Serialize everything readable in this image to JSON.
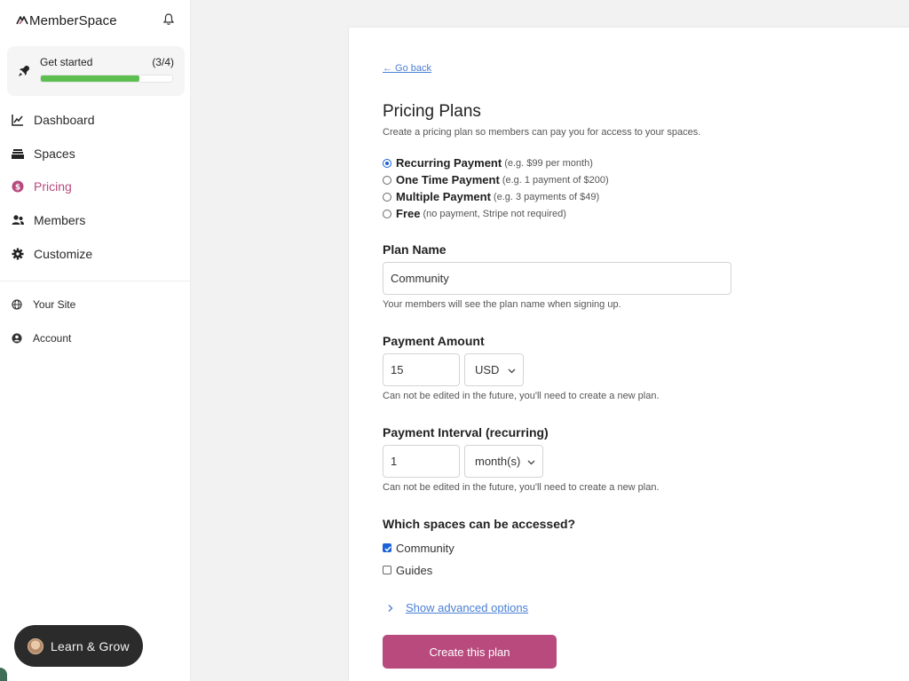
{
  "sidebar": {
    "brand": "MemberSpace",
    "get_started": {
      "title": "Get started",
      "count": "(3/4)",
      "progress": 0.75
    },
    "nav": [
      {
        "label": "Dashboard",
        "icon": "chart-icon"
      },
      {
        "label": "Spaces",
        "icon": "stack-icon"
      },
      {
        "label": "Pricing",
        "icon": "dollar-icon",
        "active": true
      },
      {
        "label": "Members",
        "icon": "people-icon"
      },
      {
        "label": "Customize",
        "icon": "gear-icon"
      }
    ],
    "secondary": [
      {
        "label": "Your Site",
        "icon": "globe-icon"
      },
      {
        "label": "Account",
        "icon": "user-circle-icon"
      }
    ],
    "learn_button": "Learn & Grow"
  },
  "main": {
    "back_link": "← Go back",
    "title": "Pricing Plans",
    "description": "Create a pricing plan so members can pay you for access to your spaces.",
    "payment_types": [
      {
        "label": "Recurring Payment",
        "hint": "(e.g. $99 per month)",
        "selected": true
      },
      {
        "label": "One Time Payment",
        "hint": "(e.g. 1 payment of $200)",
        "selected": false
      },
      {
        "label": "Multiple Payment",
        "hint": "(e.g. 3 payments of $49)",
        "selected": false
      },
      {
        "label": "Free",
        "hint": "(no payment, Stripe not required)",
        "selected": false
      }
    ],
    "plan_name": {
      "label": "Plan Name",
      "value": "Community",
      "help": "Your members will see the plan name when signing up."
    },
    "payment_amount": {
      "label": "Payment Amount",
      "value": "15",
      "currency": "USD",
      "help": "Can not be edited in the future, you'll need to create a new plan."
    },
    "payment_interval": {
      "label": "Payment Interval (recurring)",
      "value": "1",
      "unit": "month(s)",
      "help": "Can not be edited in the future, you'll need to create a new plan."
    },
    "spaces": {
      "label": "Which spaces can be accessed?",
      "options": [
        {
          "label": "Community",
          "checked": true
        },
        {
          "label": "Guides",
          "checked": false
        }
      ]
    },
    "advanced_link": "Show advanced options",
    "create_button": "Create this plan"
  },
  "colors": {
    "accent": "#b84a7e",
    "link": "#4a7fd6",
    "progress": "#5cbf4f",
    "checkbox": "#1b62d6"
  }
}
